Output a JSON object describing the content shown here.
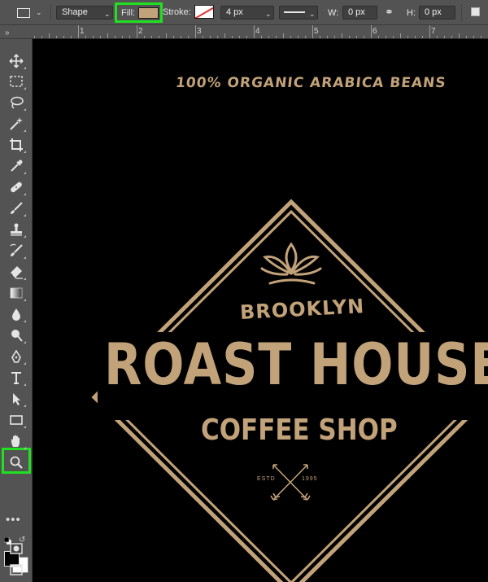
{
  "colors": {
    "panel": "#535353",
    "canvas_bg": "#000000",
    "brand_tan": "#c2a279",
    "highlight": "#20e020"
  },
  "options_bar": {
    "tool_mode": "Shape",
    "fill_label": "Fill:",
    "fill_color": "#c2a279",
    "stroke_label": "Stroke:",
    "stroke_width": "4 px",
    "w_label": "W:",
    "w_value": "0 px",
    "h_label": "H:",
    "h_value": "0 px"
  },
  "ruler": {
    "labels": [
      "1",
      "2",
      "3",
      "4",
      "5",
      "6",
      "7"
    ]
  },
  "toolbar": {
    "tools": [
      {
        "name": "move-tool",
        "icon": "move-icon"
      },
      {
        "name": "rectangular-marquee-tool",
        "icon": "marquee-icon"
      },
      {
        "name": "lasso-tool",
        "icon": "lasso-icon"
      },
      {
        "name": "magic-wand-tool",
        "icon": "magic-wand-icon"
      },
      {
        "name": "crop-tool",
        "icon": "crop-icon"
      },
      {
        "name": "eyedropper-tool",
        "icon": "eyedropper-icon"
      },
      {
        "name": "healing-brush-tool",
        "icon": "bandage-icon"
      },
      {
        "name": "brush-tool",
        "icon": "brush-icon"
      },
      {
        "name": "clone-stamp-tool",
        "icon": "stamp-icon"
      },
      {
        "name": "history-brush-tool",
        "icon": "history-brush-icon"
      },
      {
        "name": "eraser-tool",
        "icon": "eraser-icon"
      },
      {
        "name": "gradient-tool",
        "icon": "gradient-icon"
      },
      {
        "name": "blur-tool",
        "icon": "drop-icon"
      },
      {
        "name": "dodge-tool",
        "icon": "dodge-icon"
      },
      {
        "name": "pen-tool",
        "icon": "pen-icon"
      },
      {
        "name": "type-tool",
        "icon": "type-icon"
      },
      {
        "name": "path-selection-tool",
        "icon": "arrow-icon"
      },
      {
        "name": "rectangle-tool",
        "icon": "rectangle-icon",
        "selected": true
      },
      {
        "name": "hand-tool",
        "icon": "hand-icon"
      },
      {
        "name": "zoom-tool",
        "icon": "zoom-icon"
      }
    ],
    "foreground_color": "#000000",
    "background_color": "#ffffff"
  },
  "artwork": {
    "tagline": "100% ORGANIC ARABICA BEANS",
    "location": "BROOKLYN",
    "title": "ROAST HOUSE",
    "subtitle": "COFFEE SHOP",
    "estd_label": "ESTD",
    "estd_year": "1995"
  }
}
